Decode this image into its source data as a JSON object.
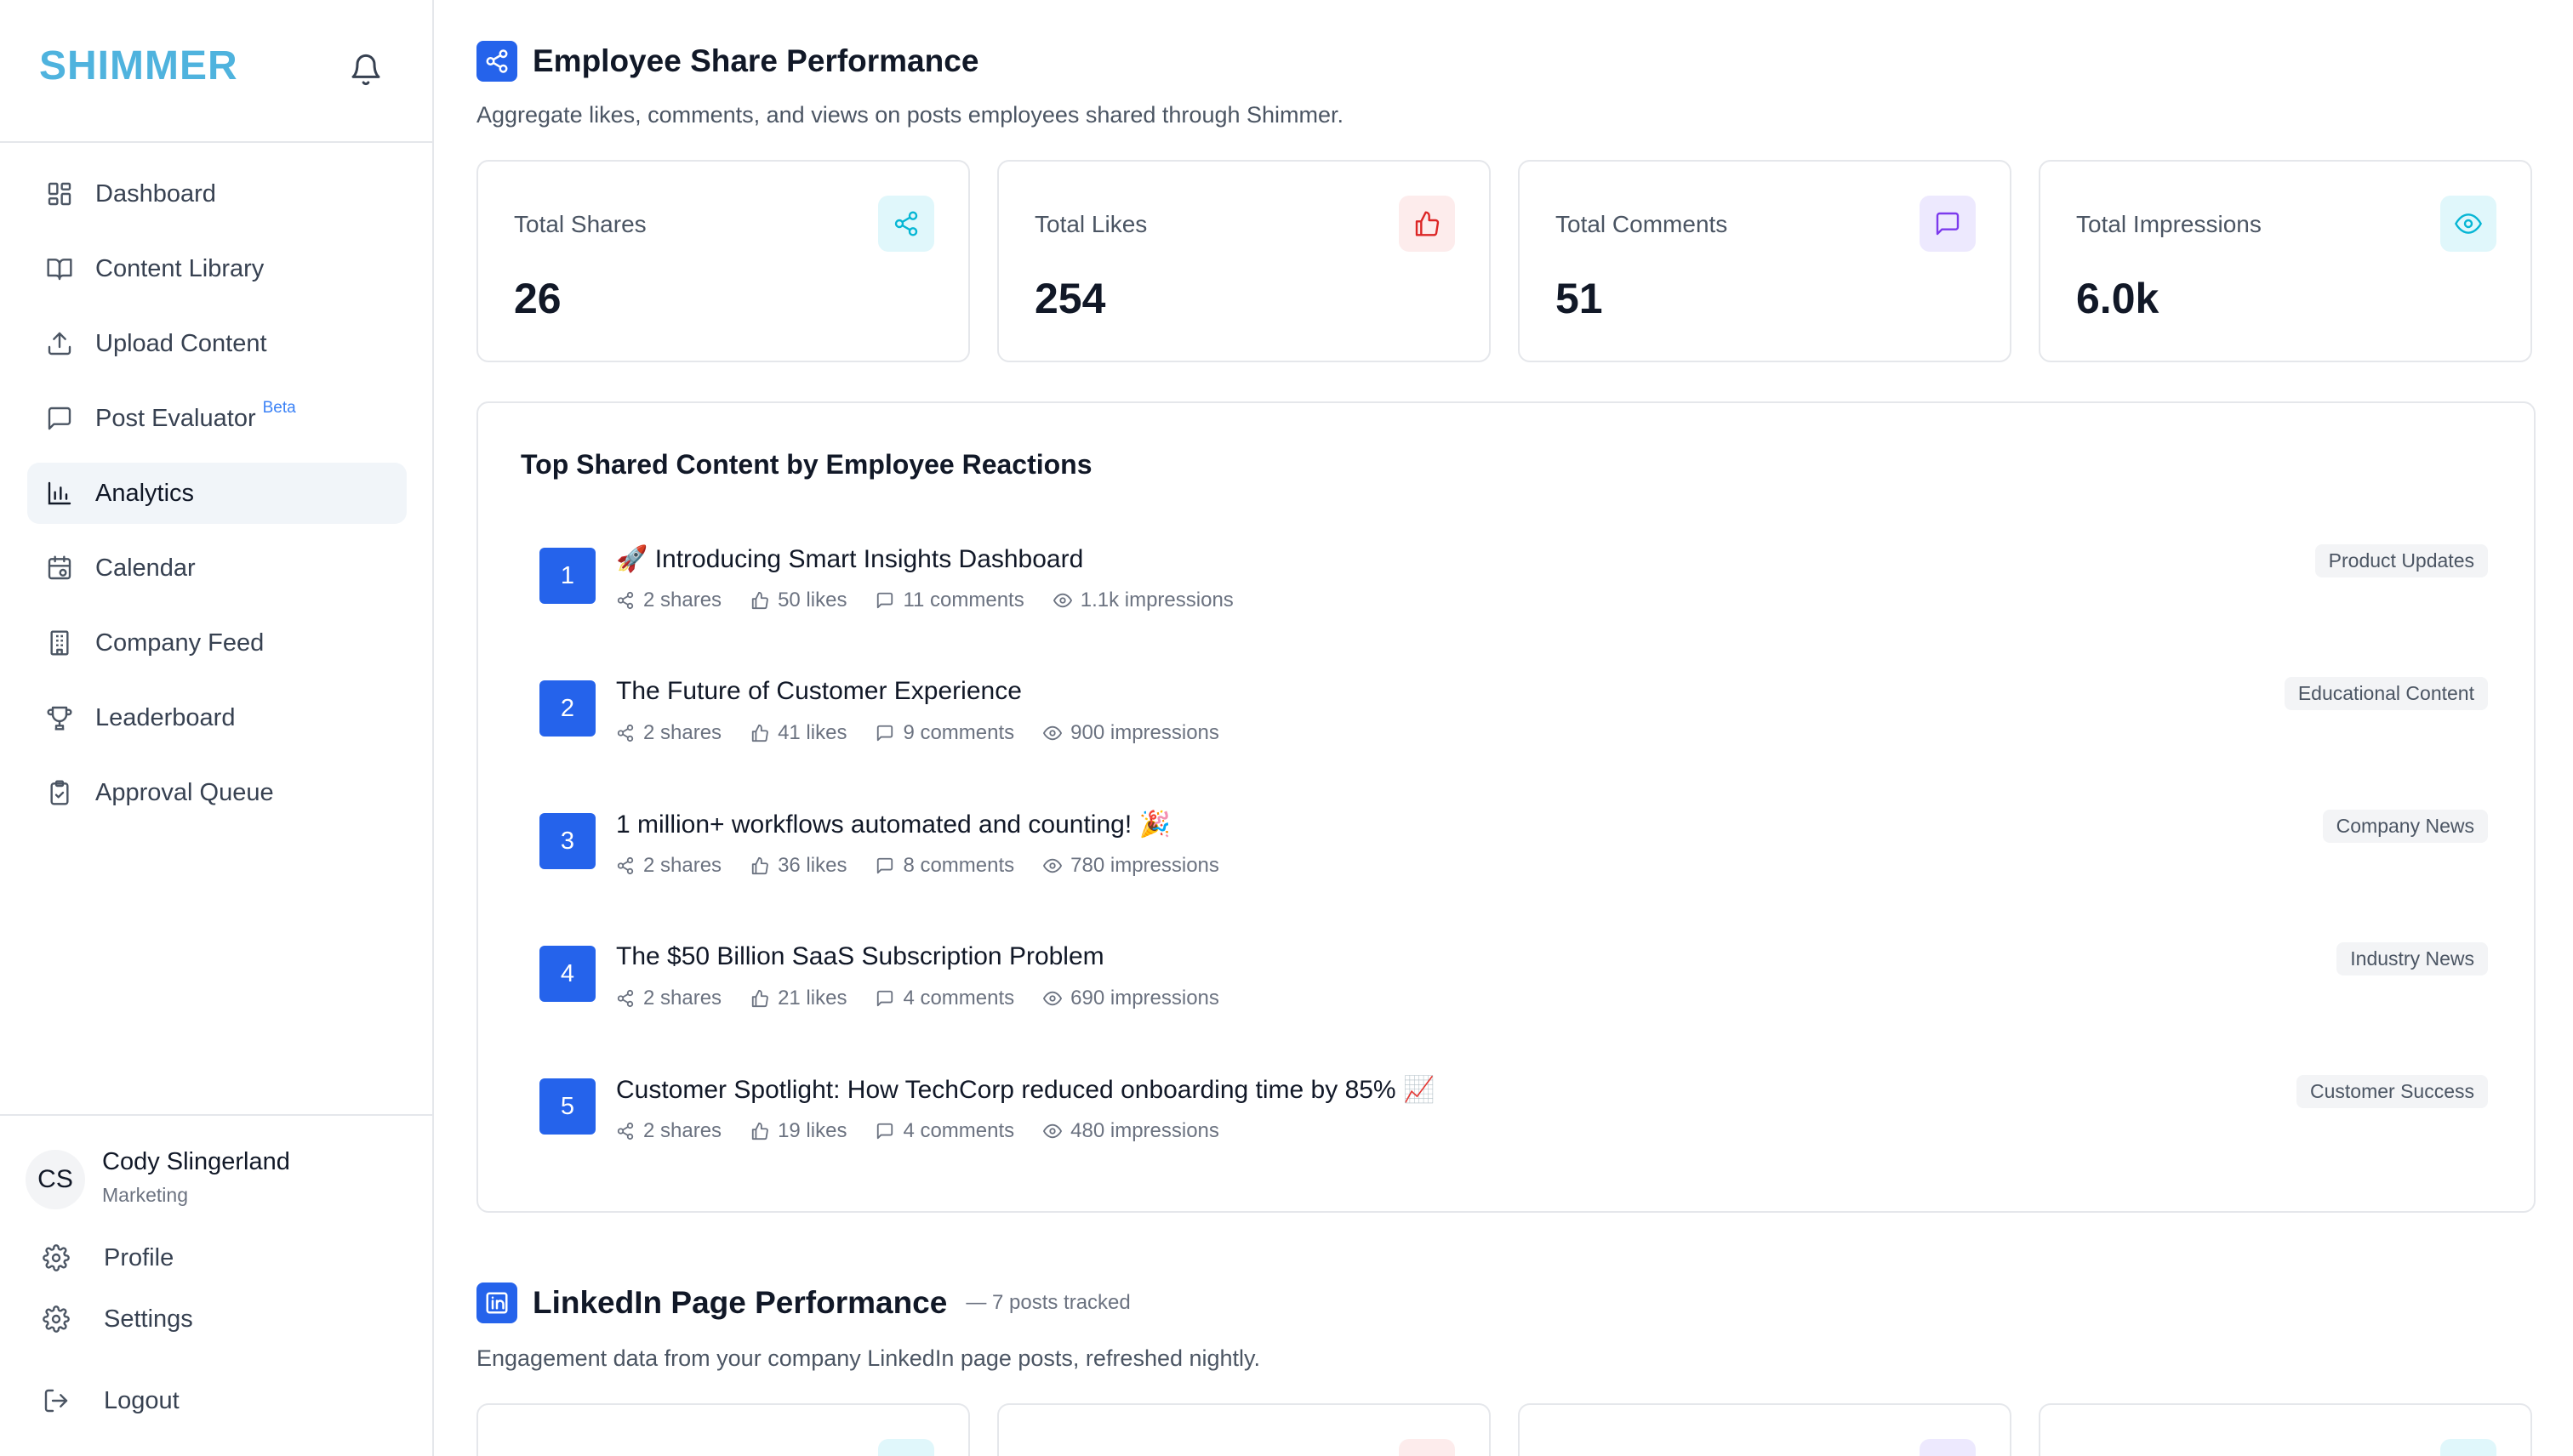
{
  "sidebar": {
    "brand": "SHIMMER",
    "items": [
      {
        "label": "Dashboard",
        "icon": "grid-icon"
      },
      {
        "label": "Content Library",
        "icon": "book-icon"
      },
      {
        "label": "Upload Content",
        "icon": "upload-icon"
      },
      {
        "label": "Post Evaluator",
        "icon": "message-icon",
        "badge": "Beta"
      },
      {
        "label": "Analytics",
        "icon": "bar-chart-icon",
        "active": true
      },
      {
        "label": "Calendar",
        "icon": "calendar-icon"
      },
      {
        "label": "Company Feed",
        "icon": "building-icon"
      },
      {
        "label": "Leaderboard",
        "icon": "trophy-icon"
      },
      {
        "label": "Approval Queue",
        "icon": "clipboard-icon"
      }
    ],
    "user": {
      "initials": "CS",
      "name": "Cody Slingerland",
      "role": "Marketing"
    },
    "profile_label": "Profile",
    "settings_label": "Settings",
    "logout_label": "Logout"
  },
  "employee_section": {
    "title": "Employee Share Performance",
    "subtitle": "Aggregate likes, comments, and views on posts employees shared through Shimmer.",
    "stats": [
      {
        "label": "Total Shares",
        "value": "26",
        "icon": "share-icon",
        "color": "#06b6d4",
        "bg": "#e0f7fb"
      },
      {
        "label": "Total Likes",
        "value": "254",
        "icon": "thumbs-up-icon",
        "color": "#dc2626",
        "bg": "#fdecec"
      },
      {
        "label": "Total Comments",
        "value": "51",
        "icon": "comment-icon",
        "color": "#7c3aed",
        "bg": "#ede9fe"
      },
      {
        "label": "Total Impressions",
        "value": "6.0k",
        "icon": "eye-icon",
        "color": "#06b6d4",
        "bg": "#e0f7fb"
      }
    ]
  },
  "top_content": {
    "title": "Top Shared Content by Employee Reactions",
    "items": [
      {
        "rank": "1",
        "title": "🚀 Introducing Smart Insights Dashboard",
        "shares": "2 shares",
        "likes": "50 likes",
        "comments": "11 comments",
        "impressions": "1.1k impressions",
        "tag": "Product Updates"
      },
      {
        "rank": "2",
        "title": "The Future of Customer Experience",
        "shares": "2 shares",
        "likes": "41 likes",
        "comments": "9 comments",
        "impressions": "900 impressions",
        "tag": "Educational Content"
      },
      {
        "rank": "3",
        "title": "1 million+ workflows automated and counting! 🎉",
        "shares": "2 shares",
        "likes": "36 likes",
        "comments": "8 comments",
        "impressions": "780 impressions",
        "tag": "Company News"
      },
      {
        "rank": "4",
        "title": "The $50 Billion SaaS Subscription Problem",
        "shares": "2 shares",
        "likes": "21 likes",
        "comments": "4 comments",
        "impressions": "690 impressions",
        "tag": "Industry News"
      },
      {
        "rank": "5",
        "title": "Customer Spotlight: How TechCorp reduced onboarding time by 85% 📈",
        "shares": "2 shares",
        "likes": "19 likes",
        "comments": "4 comments",
        "impressions": "480 impressions",
        "tag": "Customer Success"
      }
    ]
  },
  "linkedin_section": {
    "title": "LinkedIn Page Performance",
    "note": "— 7 posts tracked",
    "subtitle": "Engagement data from your company LinkedIn page posts, refreshed nightly."
  },
  "colors": {
    "brand": "#4fb3de",
    "accent": "#2563eb"
  }
}
